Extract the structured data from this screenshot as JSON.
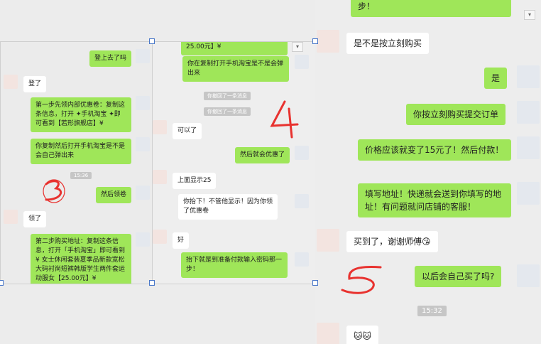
{
  "p1": {
    "msgs": [
      {
        "t": "登上去了吗"
      },
      {
        "t": "登了"
      },
      {
        "t": "第一步先领内部优惠卷：复制这条信息，打开 ✦手机淘宝 ✦即可看到【若形旗舰店】¥"
      },
      {
        "t": "你复制然后打开手机淘宝是不是会自己弹出来"
      },
      {
        "t": "然后领卷"
      },
      {
        "t": "领了"
      },
      {
        "t": "第二步购买地址：复制这条信息，打开「手机淘宝」即可看到 ¥ 女士休闲套装夏季品新款宽松大码衬尚短裤韩版学生两件套运动服女【25.00元】¥"
      }
    ],
    "time": "15:36",
    "annotation": "3"
  },
  "p2": {
    "msgs": [
      {
        "t": "25.00元】¥"
      },
      {
        "t": "你在复制打开手机淘宝是不是会弹出来"
      },
      {
        "t": "可以了"
      },
      {
        "t": "然后就会优惠了"
      },
      {
        "t": "上面显示25"
      },
      {
        "t": "你抬下！不管他显示！因为你领了优惠卷"
      },
      {
        "t": "好"
      },
      {
        "t": "抬下就是到准备付款输入密码那一步！"
      }
    ],
    "recall1": "你撤回了一条消息",
    "recall2": "你撤回了一条消息",
    "annotation": "4"
  },
  "p3": {
    "msgs": [
      {
        "t": "步！"
      },
      {
        "t": "是不是按立刻购买"
      },
      {
        "t": "是"
      },
      {
        "t": "你按立刻购买提交订单"
      },
      {
        "t": "价格应该就变了15元了！然后付款！"
      },
      {
        "t": "填写地址！快递就会送到你填写的地址！有问题就问店铺的客服！"
      },
      {
        "t": "买到了，谢谢师傅😘"
      },
      {
        "t": "以后会自己买了吗?"
      },
      {
        "t": "🐱🐱"
      }
    ],
    "time": "15:32",
    "annotation": "5"
  },
  "colors": {
    "green": "#9fe659",
    "white": "#ffffff",
    "annotation": "#e8322f"
  }
}
